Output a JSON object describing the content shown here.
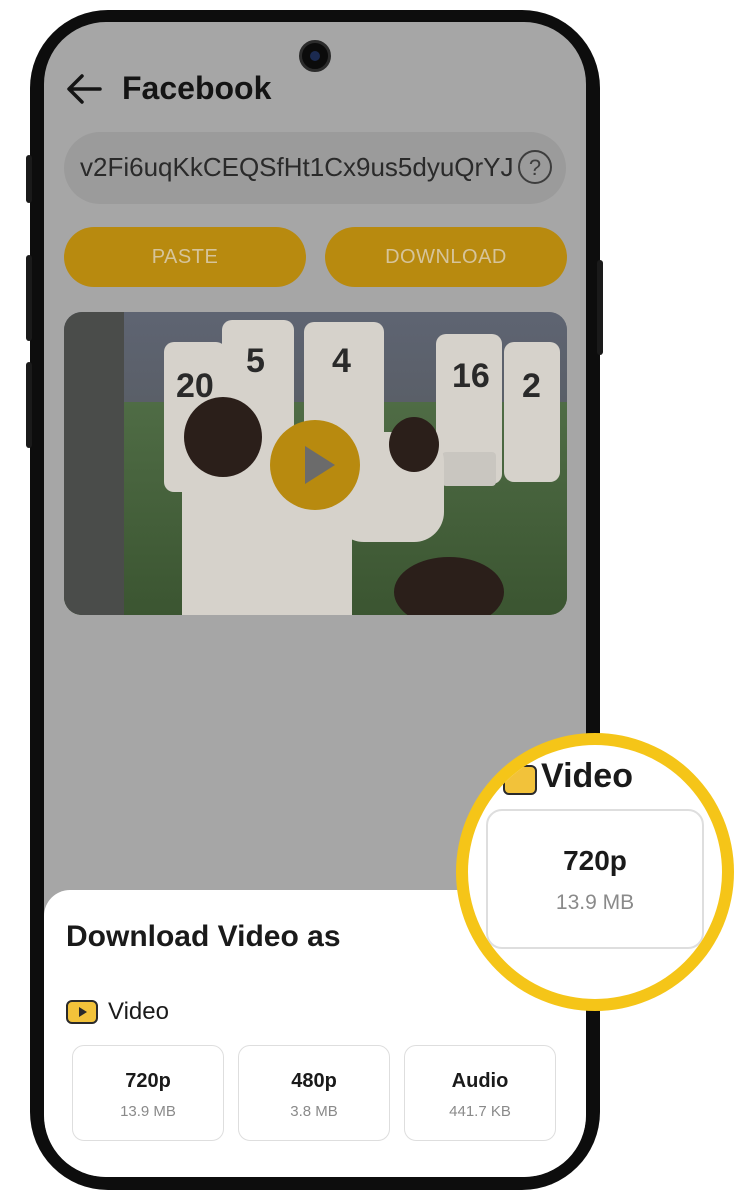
{
  "header": {
    "title": "Facebook"
  },
  "url_input": {
    "value": "v2Fi6uqKkCEQSfHt1Cx9us5dyuQrYJ",
    "help_symbol": "?"
  },
  "buttons": {
    "paste": "PASTE",
    "download": "DOWNLOAD"
  },
  "video_preview": {
    "jersey_numbers": [
      "20",
      "5",
      "4",
      "16",
      "2"
    ]
  },
  "sheet": {
    "title": "Download Video as",
    "section_label": "Video",
    "options": [
      {
        "quality": "720p",
        "size": "13.9 MB"
      },
      {
        "quality": "480p",
        "size": "3.8 MB"
      },
      {
        "quality": "Audio",
        "size": "441.7 KB"
      }
    ]
  },
  "zoom": {
    "label": "Video",
    "quality": "720p",
    "size": "13.9 MB"
  },
  "colors": {
    "accent": "#f5c518",
    "button": "#b88a0f",
    "overlay": "#a6a6a6"
  }
}
